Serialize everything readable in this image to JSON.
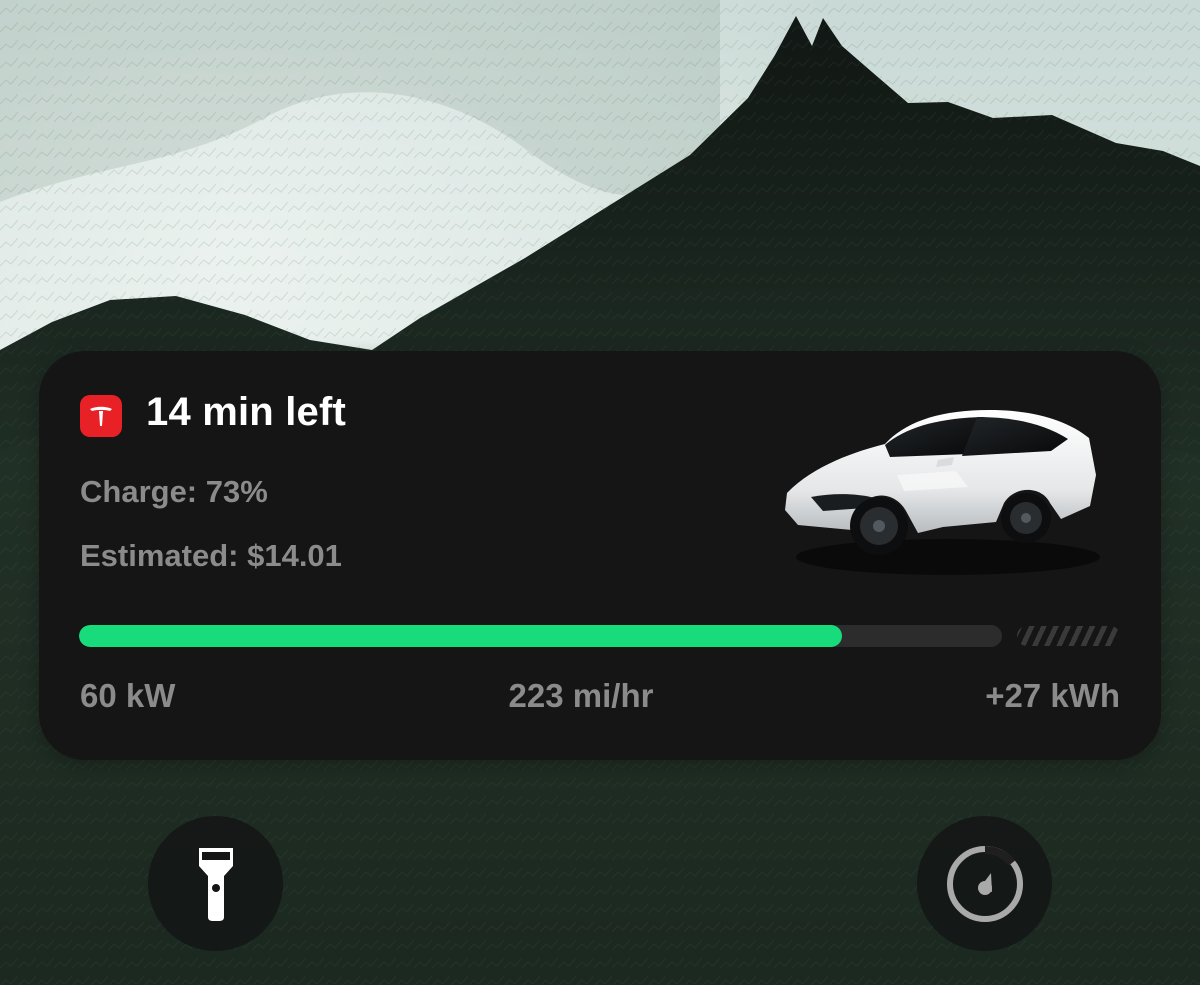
{
  "live_activity": {
    "app_icon": "tesla-logo-icon",
    "title": "14 min left",
    "charge_text": "Charge: 73%",
    "estimate_text": "Estimated: $14.01",
    "vehicle_image": "tesla-model-y-white",
    "progress": 0.827,
    "charge_limit_indicator": "hatched-limit-marker",
    "stats": {
      "power": "60 kW",
      "rate": "223 mi/hr",
      "energy": "+27 kWh"
    },
    "colors": {
      "card": "#151515",
      "progress": "#18db7c",
      "brand": "#e82127"
    }
  },
  "lockscreen": {
    "flashlight_icon": "flashlight-icon",
    "timer_icon": "timer-icon"
  },
  "background": {
    "image": "dark-green-mountain-wallpaper"
  }
}
